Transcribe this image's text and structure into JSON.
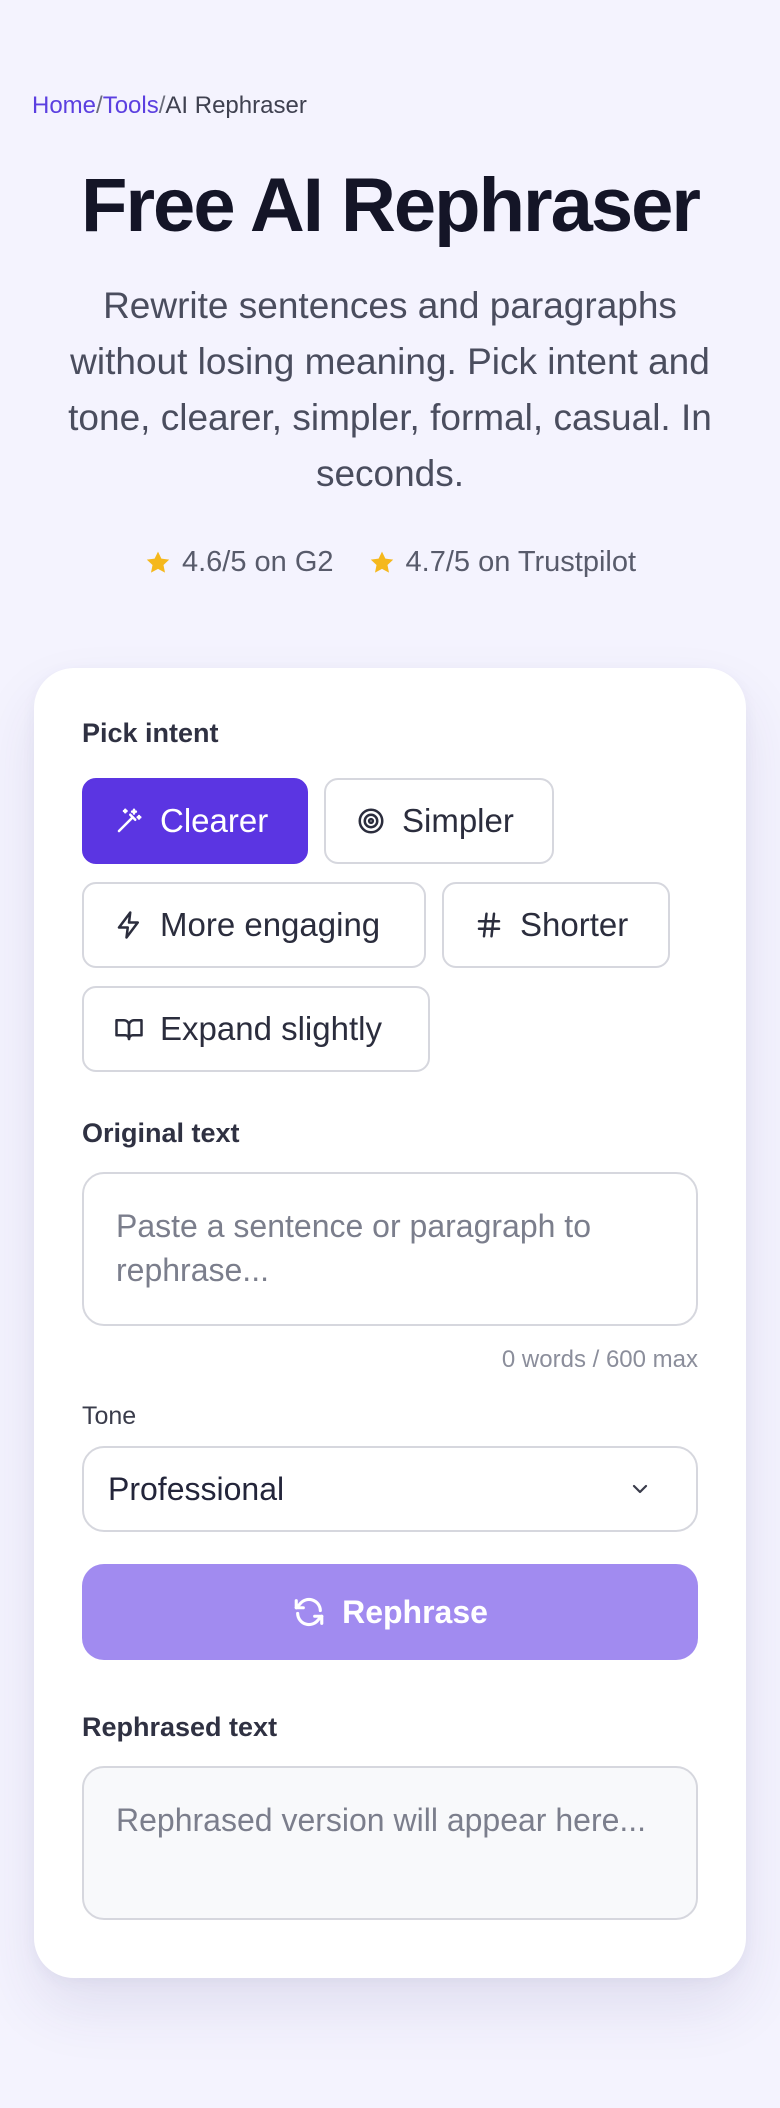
{
  "breadcrumb": {
    "home": "Home",
    "tools": "Tools",
    "current": "AI Rephraser",
    "separator": "/"
  },
  "page_title": "Free AI Rephraser",
  "subtitle": "Rewrite sentences and paragraphs without losing meaning. Pick intent and tone, clearer, simpler, formal, casual. In seconds.",
  "ratings": [
    {
      "text": "4.6/5 on G2",
      "icon": "star-icon"
    },
    {
      "text": "4.7/5 on Trustpilot",
      "icon": "star-icon"
    }
  ],
  "intent": {
    "label": "Pick intent",
    "selected": "Clearer",
    "options": [
      {
        "label": "Clearer",
        "icon": "magic-wand-icon"
      },
      {
        "label": "Simpler",
        "icon": "target-icon"
      },
      {
        "label": "More engaging",
        "icon": "lightning-icon"
      },
      {
        "label": "Shorter",
        "icon": "hash-icon"
      },
      {
        "label": "Expand slightly",
        "icon": "book-open-icon"
      }
    ]
  },
  "original": {
    "label": "Original text",
    "placeholder": "Paste a sentence or paragraph to rephrase...",
    "counter": "0 words / 600 max"
  },
  "tone": {
    "label": "Tone",
    "value": "Professional",
    "icon": "chevron-down-icon"
  },
  "rephrase_button": {
    "label": "Rephrase",
    "icon": "refresh-icon"
  },
  "result": {
    "label": "Rephrased text",
    "placeholder": "Rephrased version will appear here..."
  },
  "colors": {
    "accent": "#5b35e2",
    "accent_light": "#a18bf0",
    "background": "#f4f3fe",
    "star": "#f5b81c"
  }
}
